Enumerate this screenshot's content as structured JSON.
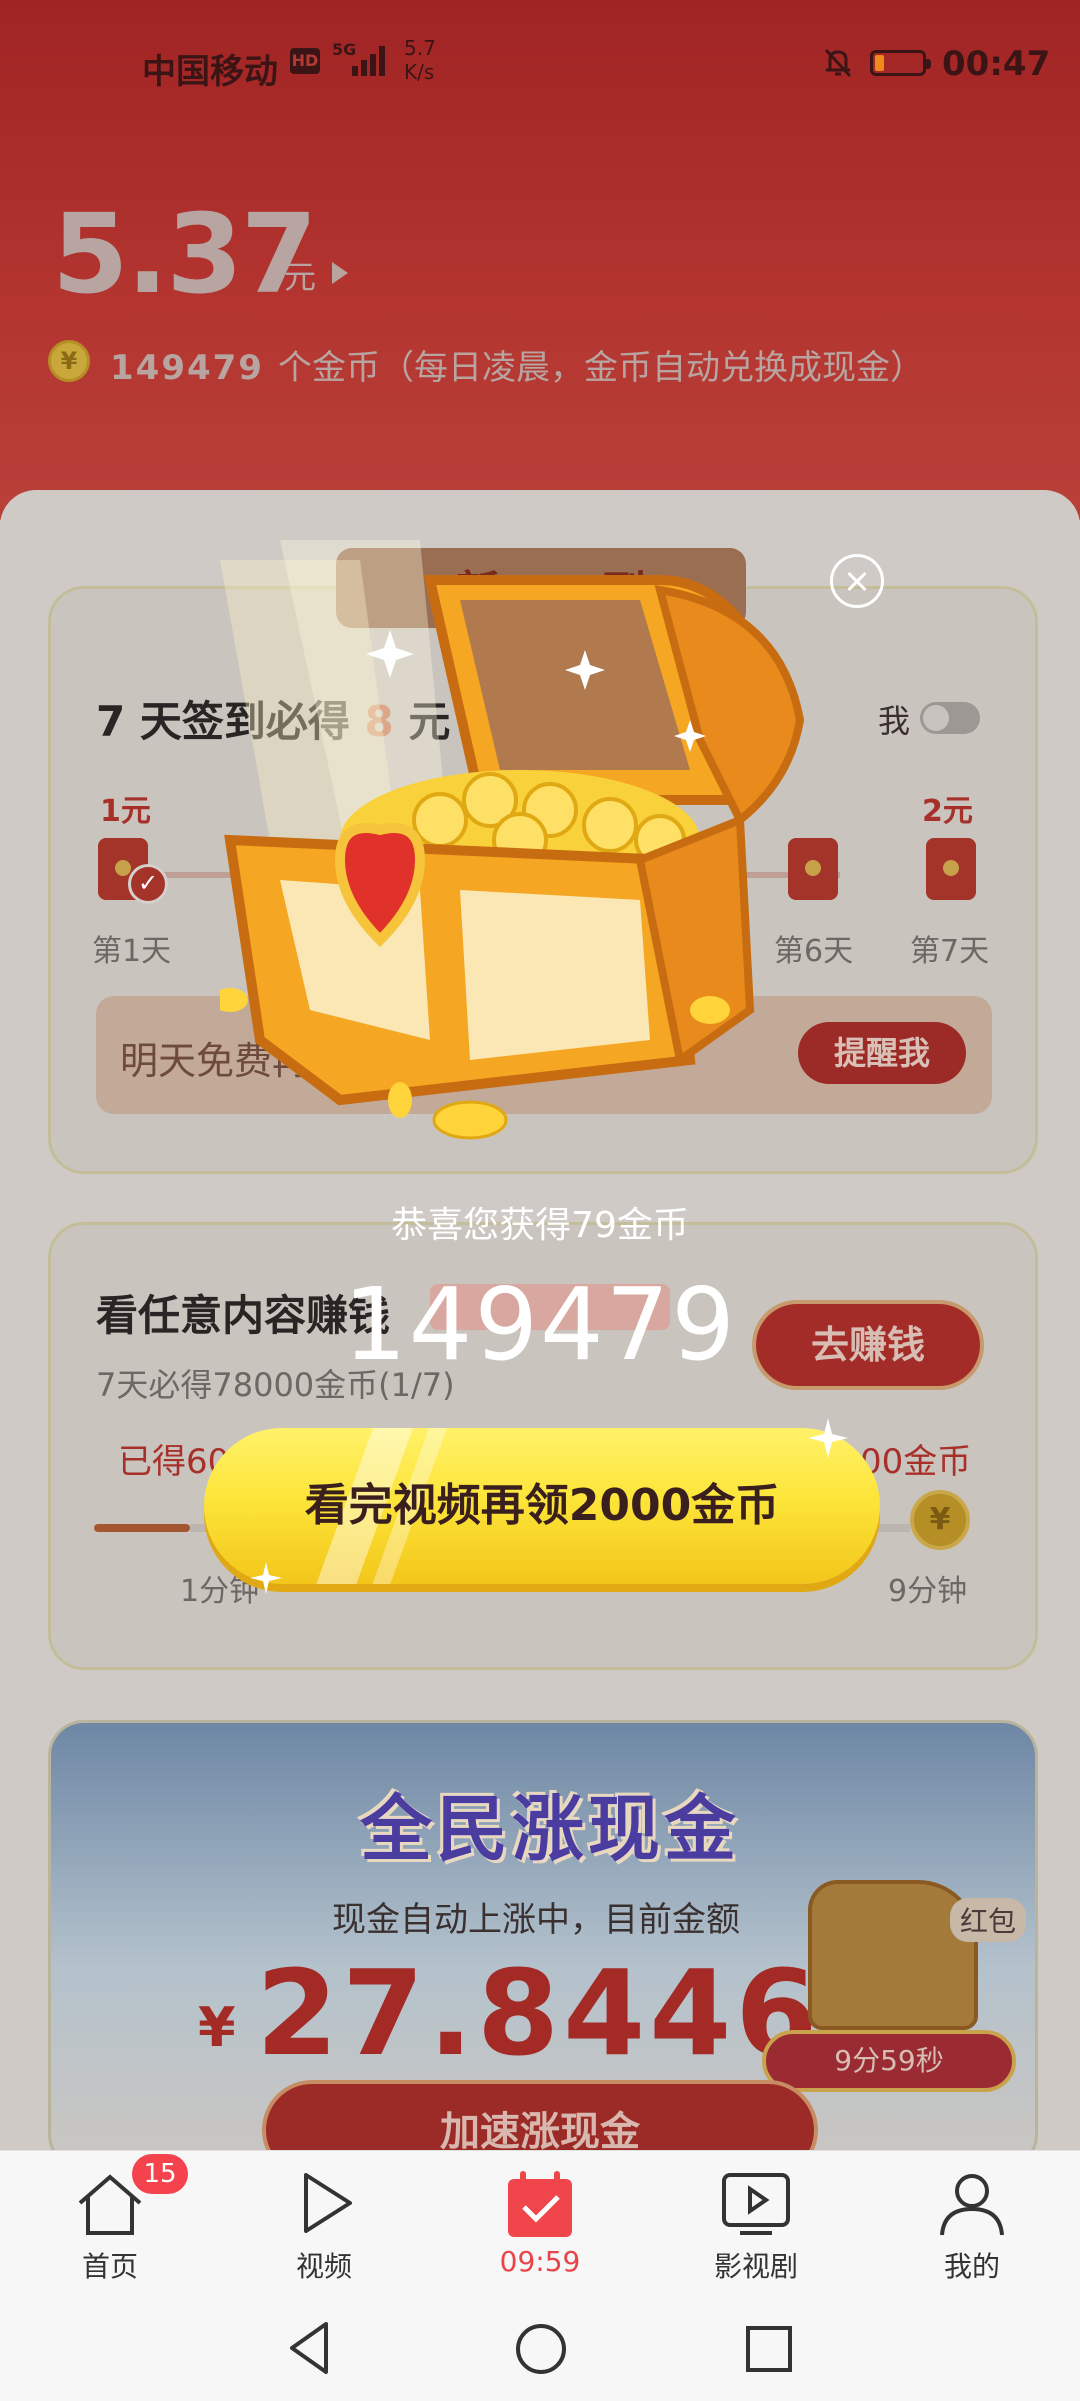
{
  "status_bar": {
    "carrier": "中国移动",
    "hd": "HD",
    "network": "5G",
    "speed_value": "5.7",
    "speed_unit": "K/s",
    "time": "00:47",
    "battery_level": 0.2
  },
  "header": {
    "balance": "5.37",
    "balance_unit": "元",
    "coin_icon": "¥",
    "coin_count": "149479",
    "coin_note": "个金币（每日凌晨，金币自动兑换成现金）"
  },
  "checkin_card": {
    "ribbon_visible": "新",
    "ribbon_visible_end": "到",
    "title_prefix": "7 天签到必得 ",
    "title_highlight": "8",
    "title_suffix": " 元",
    "remind_label": "我",
    "day1_amount": "1元",
    "day7_amount": "2元",
    "day_labels": [
      "第1天",
      "第6天",
      "第7天"
    ],
    "tomorrow_text": "明天免费再领",
    "remind_button": "提醒我"
  },
  "watch_card": {
    "title": "看任意内容赚钱",
    "subtitle": "7天必得78000金币(1/7)",
    "earn_button": "去赚钱",
    "earned_label": "已得60",
    "right_label": "00金币",
    "time_label_1": "1分钟",
    "time_label_3": "9分钟",
    "coin_icon": "¥"
  },
  "cash_card": {
    "title": "全民涨现金",
    "subtitle": "现金自动上涨中，目前金额",
    "currency": "¥",
    "amount": "27.84462",
    "hongbao_label": "红包",
    "timer": "9分59秒",
    "speed_button": "加速涨现金"
  },
  "popup": {
    "congrats": "恭喜您获得79金币",
    "coin_total": "149479",
    "cta_button": "看完视频再领2000金币"
  },
  "bottom_nav": {
    "tabs": [
      {
        "label": "首页",
        "icon": "home-icon"
      },
      {
        "label": "视频",
        "icon": "play-icon"
      },
      {
        "label": "09:59",
        "icon": "calendar-check-icon",
        "active": true
      },
      {
        "label": "影视剧",
        "icon": "tv-play-icon"
      },
      {
        "label": "我的",
        "icon": "person-icon"
      }
    ],
    "home_badge": "15",
    "active_color": "#e8454a"
  },
  "system_nav": {
    "buttons": [
      "back-icon",
      "home-circle-icon",
      "recents-icon"
    ]
  }
}
